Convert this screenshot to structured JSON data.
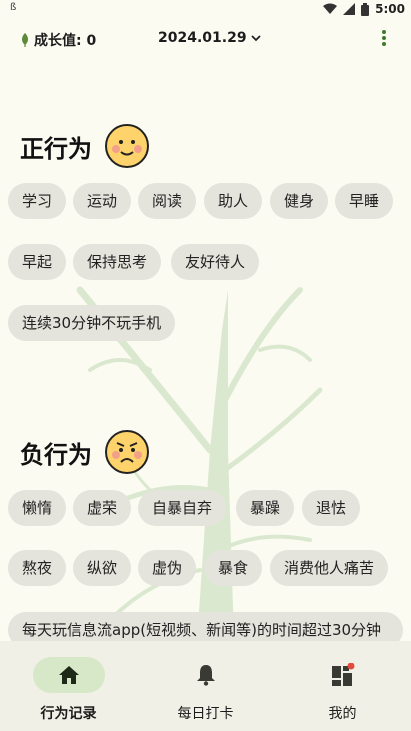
{
  "statusbar": {
    "left_text": "ß",
    "time": "5:00"
  },
  "appbar": {
    "growth_label": "成长值: 0",
    "date": "2024.01.29"
  },
  "positive": {
    "title": "正行为",
    "chips": [
      "学习",
      "运动",
      "阅读",
      "助人",
      "健身",
      "早睡",
      "早起",
      "保持思考",
      "友好待人",
      "连续30分钟不玩手机"
    ]
  },
  "negative": {
    "title": "负行为",
    "chips": [
      "懒惰",
      "虚荣",
      "自暴自弃",
      "暴躁",
      "退怯",
      "熬夜",
      "纵欲",
      "虚伪",
      "暴食",
      "消费他人痛苦",
      "每天玩信息流app(短视频、新闻等)的时间超过30分钟"
    ]
  },
  "nav": {
    "items": [
      {
        "label": "行为记录",
        "icon": "home-icon",
        "active": true
      },
      {
        "label": "每日打卡",
        "icon": "bell-icon",
        "active": false
      },
      {
        "label": "我的",
        "icon": "dashboard-icon",
        "active": false
      }
    ]
  },
  "colors": {
    "background": "#fbfbf2",
    "chip": "#e4e3dc",
    "accent": "#3d7a2e",
    "nav_active_pill": "#d6e8c7"
  }
}
